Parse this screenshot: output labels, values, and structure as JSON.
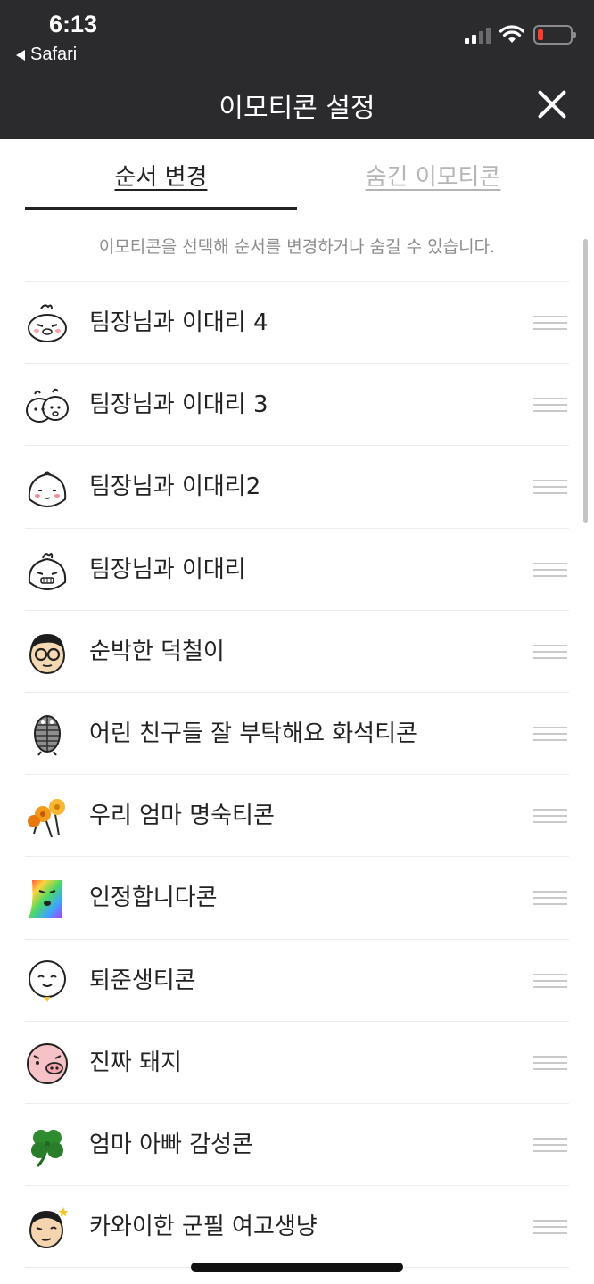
{
  "status_bar": {
    "time": "6:13",
    "back_app": "Safari"
  },
  "header": {
    "title": "이모티콘 설정",
    "close_icon": "close-icon"
  },
  "tabs": [
    {
      "label": "순서 변경",
      "active": true
    },
    {
      "label": "숨긴 이모티콘",
      "active": false
    }
  ],
  "hint": "이모티콘을 선택해 순서를 변경하거나 숨길 수 있습니다.",
  "items": [
    {
      "label": "팀장님과 이대리 4",
      "icon": "bun-character-icon"
    },
    {
      "label": "팀장님과 이대리 3",
      "icon": "two-buns-icon"
    },
    {
      "label": "팀장님과 이대리2",
      "icon": "bun-blush-icon"
    },
    {
      "label": "팀장님과 이대리",
      "icon": "bun-grin-icon"
    },
    {
      "label": "순박한 덕철이",
      "icon": "glasses-man-icon"
    },
    {
      "label": "어린 친구들 잘 부탁해요 화석티콘",
      "icon": "trilobite-icon"
    },
    {
      "label": "우리 엄마 명숙티콘",
      "icon": "flower-icon"
    },
    {
      "label": "인정합니다콘",
      "icon": "rainbow-face-icon"
    },
    {
      "label": "퇴준생티콘",
      "icon": "smile-face-icon"
    },
    {
      "label": "진짜 돼지",
      "icon": "pig-icon"
    },
    {
      "label": "엄마 아빠 감성콘",
      "icon": "clover-icon"
    },
    {
      "label": "카와이한 군필 여고생냥",
      "icon": "soldier-face-icon"
    }
  ],
  "colors": {
    "header_bg": "#2b2b2e",
    "battery_low": "#ff3b30"
  }
}
